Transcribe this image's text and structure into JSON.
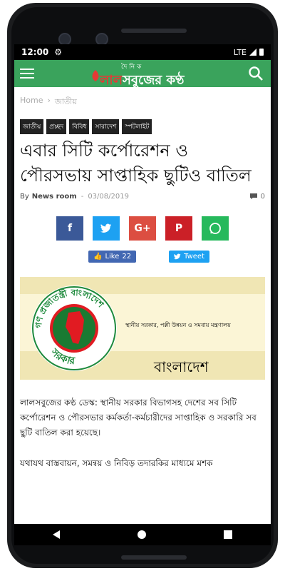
{
  "status": {
    "time": "12:00",
    "network": "LTE"
  },
  "header": {
    "tagline": "দৈ নি ক",
    "name_red": "লাল",
    "name_rest": "সবুজের কণ্ঠ"
  },
  "breadcrumb": {
    "home": "Home",
    "separator": "›",
    "category": "জাতীয়"
  },
  "tags": [
    "জাতীয়",
    "প্রচ্ছদ",
    "বিবিধ",
    "সারাদেশ",
    "স্পটলাইট"
  ],
  "article": {
    "title": "এবার সিটি কর্পোরেশন ও পৌরসভায় সাপ্তাহিক ছুটিও বাতিল",
    "by": "By",
    "author": "News room",
    "date_sep": "-",
    "date": "03/08/2019",
    "comments": "0",
    "paragraphs": [
      "লালসবুজের কণ্ঠ ডেস্ক: স্থানীয় সরকার বিভাগসহ দেশের সব সিটি কর্পোরেশন ও পৌরসভার কর্মকর্তা-কর্মচারীদের সাপ্তাহিক ও সরকারি সব ছুটি বাতিল করা হয়েছে।",
      "যথাযথ বাস্তবায়ন, সমন্বয় ও নিবিড় তদারকির মাধ্যমে মশক"
    ]
  },
  "share": {
    "facebook": "f",
    "twitter": "t",
    "googleplus": "G+",
    "pinterest": "P",
    "whatsapp": "w",
    "colors": {
      "facebook": "#3b5998",
      "twitter": "#1da1f2",
      "googleplus": "#dc4e41",
      "pinterest": "#cb2027",
      "whatsapp": "#26b95c"
    }
  },
  "social": {
    "like_label": "Like",
    "like_count": "22",
    "tweet_label": "Tweet"
  },
  "banner": {
    "ministry": "স্থানীয় সরকার, পল্লী উন্নয়ন ও সমবায় মন্ত্রণালয়",
    "country": "বাংলাদেশ",
    "seal_top": "গণ প্রজাতন্ত্রী বাংলাদেশ",
    "seal_bottom": "সরকার"
  },
  "colors": {
    "appbar": "#3aa35c",
    "brand_red": "#e53935"
  }
}
